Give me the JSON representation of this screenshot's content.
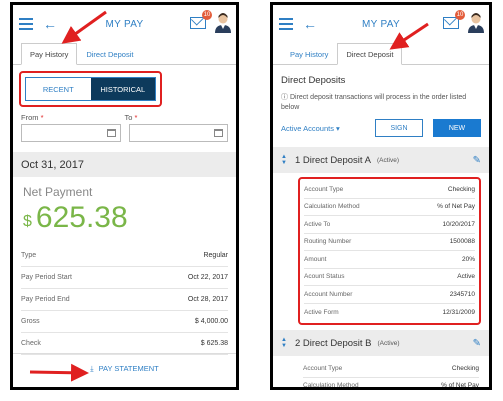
{
  "left": {
    "header_title": "MY PAY",
    "badge_count": "10",
    "tabs": [
      "Pay History",
      "Direct Deposit"
    ],
    "segments": {
      "recent": "RECENT",
      "historical": "HISTORICAL"
    },
    "from_label": "From",
    "to_label": "To",
    "required_mark": "*",
    "period": "Oct 31, 2017",
    "net_label": "Net Payment",
    "currency": "$",
    "net_amount": "625.38",
    "rows": [
      {
        "k": "Type",
        "v": "Regular"
      },
      {
        "k": "Pay Period Start",
        "v": "Oct 22, 2017"
      },
      {
        "k": "Pay Period End",
        "v": "Oct 28, 2017"
      },
      {
        "k": "Gross",
        "v": "$ 4,000.00"
      },
      {
        "k": "Check",
        "v": "$ 625.38"
      }
    ],
    "pay_statement": "PAY STATEMENT"
  },
  "right": {
    "header_title": "MY PAY",
    "badge_count": "10",
    "tabs": [
      "Pay History",
      "Direct Deposit"
    ],
    "heading": "Direct Deposits",
    "info": "Direct deposit transactions will process in the order listed below",
    "active_accounts": "Active Accounts",
    "sign": "SIGN",
    "new": "NEW",
    "deposit1": {
      "name": "1 Direct Deposit A",
      "status": "(Active)",
      "rows": [
        {
          "k": "Account Type",
          "v": "Checking"
        },
        {
          "k": "Calculation Method",
          "v": "% of Net Pay"
        },
        {
          "k": "Active To",
          "v": "10/20/2017"
        },
        {
          "k": "Routing Number",
          "v": "1500088"
        },
        {
          "k": "Amount",
          "v": "20%"
        },
        {
          "k": "Acount Status",
          "v": "Active"
        },
        {
          "k": "Account Number",
          "v": "2345710"
        },
        {
          "k": "Active Form",
          "v": "12/31/2009"
        }
      ]
    },
    "deposit2": {
      "name": "2 Direct Deposit B",
      "status": "(Active)",
      "rows": [
        {
          "k": "Account Type",
          "v": "Checking"
        },
        {
          "k": "Calculation Method",
          "v": "% of Net Pay"
        }
      ]
    }
  },
  "colors": {
    "accent": "#2f7fc4",
    "highlight": "#e02020",
    "net": "#7ab648",
    "dark": "#0d3a5c"
  }
}
